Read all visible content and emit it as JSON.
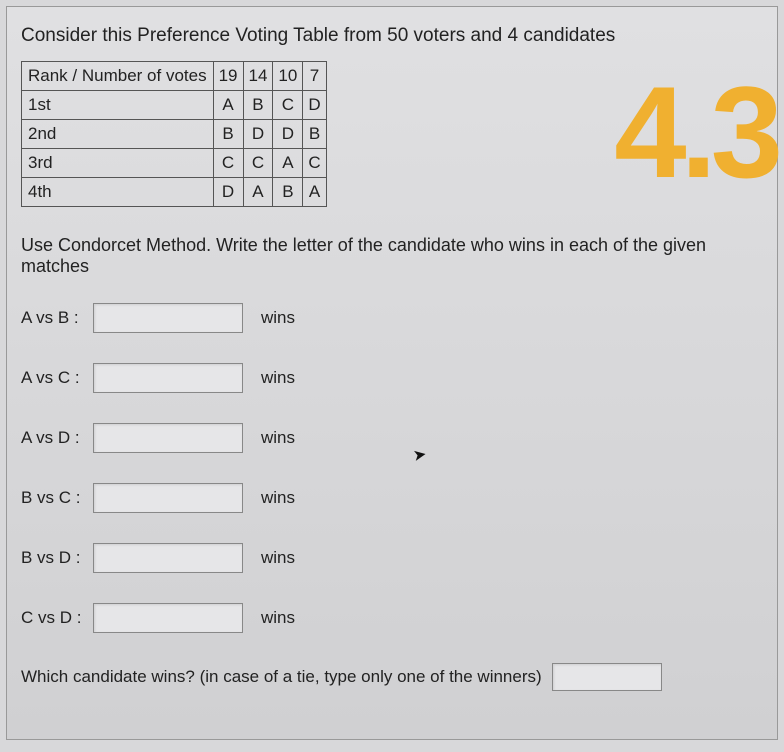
{
  "title": "Consider this Preference Voting Table from 50 voters and 4 candidates",
  "table": {
    "header_label": "Rank / Number of votes",
    "vote_counts": [
      "19",
      "14",
      "10",
      "7"
    ],
    "rows": [
      {
        "rank": "1st",
        "cells": [
          "A",
          "B",
          "C",
          "D"
        ]
      },
      {
        "rank": "2nd",
        "cells": [
          "B",
          "D",
          "D",
          "B"
        ]
      },
      {
        "rank": "3rd",
        "cells": [
          "C",
          "C",
          "A",
          "C"
        ]
      },
      {
        "rank": "4th",
        "cells": [
          "D",
          "A",
          "B",
          "A"
        ]
      }
    ]
  },
  "instruction": "Use Condorcet Method. Write the letter of the candidate who wins in each of the given matches",
  "matches": [
    {
      "label": "A vs B :",
      "suffix": "wins"
    },
    {
      "label": "A vs C :",
      "suffix": "wins"
    },
    {
      "label": "A vs D :",
      "suffix": "wins"
    },
    {
      "label": "B vs C :",
      "suffix": "wins"
    },
    {
      "label": "B vs D :",
      "suffix": "wins"
    },
    {
      "label": "C vs D :",
      "suffix": "wins"
    }
  ],
  "final_question": "Which candidate wins? (in case of a tie, type only one of the winners)",
  "annotation": "4.3",
  "chart_data": {
    "type": "table",
    "description": "Preference voting ballots (Condorcet method input)",
    "total_voters": 50,
    "candidates": [
      "A",
      "B",
      "C",
      "D"
    ],
    "columns": [
      {
        "votes": 19,
        "ranking": [
          "A",
          "B",
          "C",
          "D"
        ]
      },
      {
        "votes": 14,
        "ranking": [
          "B",
          "D",
          "C",
          "A"
        ]
      },
      {
        "votes": 10,
        "ranking": [
          "C",
          "D",
          "A",
          "B"
        ]
      },
      {
        "votes": 7,
        "ranking": [
          "D",
          "B",
          "C",
          "A"
        ]
      }
    ]
  }
}
